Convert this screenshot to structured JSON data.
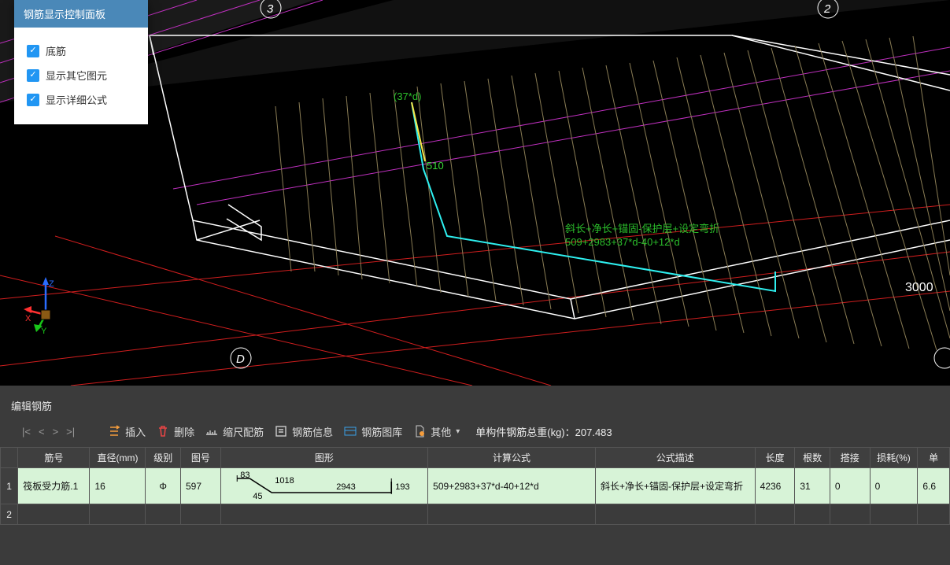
{
  "panel": {
    "title": "钢筋显示控制面板",
    "items": [
      {
        "label": "底筋",
        "checked": true
      },
      {
        "label": "显示其它图元",
        "checked": true
      },
      {
        "label": "显示详细公式",
        "checked": true
      }
    ]
  },
  "axis_labels": [
    "3",
    "2",
    "D"
  ],
  "viewport_annotations": {
    "green_top": "(37*d)",
    "yellow_dim": "510",
    "formula_line1": "斜长+净长+锚固-保护层+设定弯折",
    "formula_line2": "509+2983+37*d-40+12*d",
    "dim_right": "3000"
  },
  "section_title": "编辑钢筋",
  "toolbar": {
    "insert": "插入",
    "delete": "删除",
    "scale": "缩尺配筋",
    "info": "钢筋信息",
    "library": "钢筋图库",
    "other": "其他",
    "weight_label": "单构件钢筋总重(kg)：",
    "weight_value": "207.483"
  },
  "table": {
    "headers": [
      "筋号",
      "直径(mm)",
      "级别",
      "图号",
      "图形",
      "计算公式",
      "公式描述",
      "长度",
      "根数",
      "搭接",
      "损耗(%)",
      "单"
    ],
    "rows": [
      {
        "name": "筏板受力筋.1",
        "dia": "16",
        "grade": "Φ",
        "tuhao": "597",
        "shape_dims": {
          "a": "83",
          "b": "45",
          "c": "1018",
          "d": "2943",
          "e": "193"
        },
        "formula": "509+2983+37*d-40+12*d",
        "desc": "斜长+净长+锚固-保护层+设定弯折",
        "len": "4236",
        "count": "31",
        "overlap": "0",
        "loss": "0",
        "last": "6.6"
      }
    ]
  }
}
